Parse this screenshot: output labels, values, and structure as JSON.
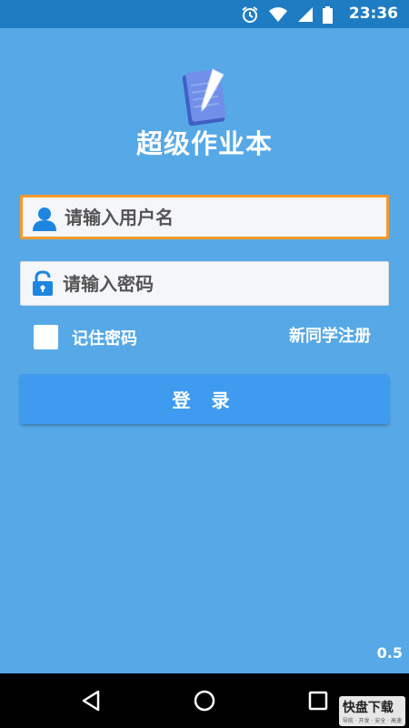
{
  "status_bar": {
    "time": "23:36",
    "icons": [
      "alarm-icon",
      "wifi-icon",
      "signal-icon",
      "battery-icon"
    ]
  },
  "app": {
    "title": "超级作业本",
    "version": "0.5"
  },
  "login_form": {
    "username_placeholder": "请输入用户名",
    "password_placeholder": "请输入密码",
    "remember_label": "记住密码",
    "register_link": "新同学注册",
    "login_button": "登 录"
  },
  "nav_bar": {
    "buttons": [
      "back-icon",
      "home-icon",
      "recents-icon"
    ]
  },
  "watermark": {
    "text": "快盘下载",
    "subtext": "导航 · 开发 · 安全 · 高速"
  },
  "colors": {
    "background": "#56a8e6",
    "status_bar": "#1e7cc3",
    "accent_border": "#f29a2c",
    "button": "#3e9bef"
  }
}
